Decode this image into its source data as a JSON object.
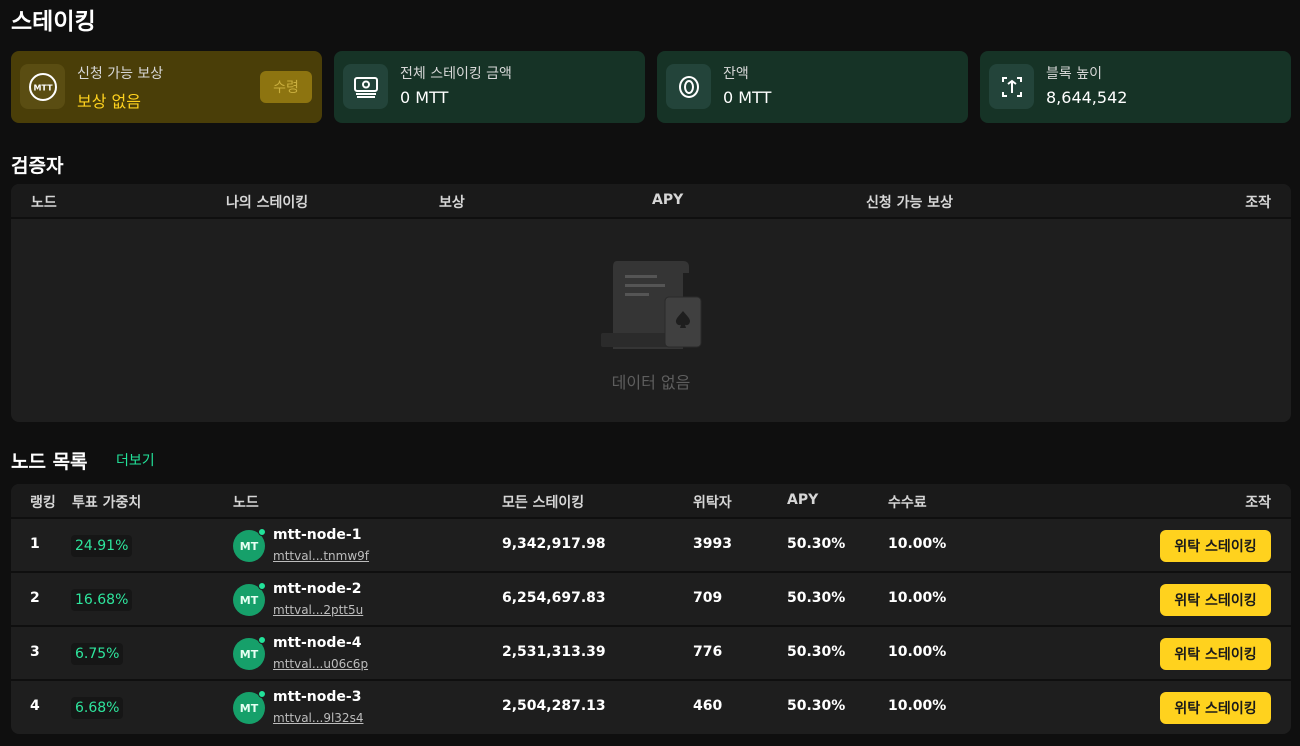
{
  "page": {
    "title": "스테이킹"
  },
  "cards": {
    "reward": {
      "label": "신청 가능 보상",
      "value": "보상 없음",
      "button": "수령",
      "icon": "mtt-coin-icon",
      "icon_text": "MTT"
    },
    "total": {
      "label": "전체 스테이킹 금액",
      "value": "0 MTT",
      "icon": "money-stack-icon"
    },
    "balance": {
      "label": "잔액",
      "value": "0 MTT",
      "icon": "coin-icon"
    },
    "block": {
      "label": "블록 높이",
      "value": "8,644,542",
      "icon": "block-icon"
    }
  },
  "validators": {
    "title": "검증자",
    "columns": [
      "노드",
      "나의 스테이킹",
      "보상",
      "APY",
      "신청 가능 보상",
      "조작"
    ],
    "empty_text": "데이터 없음"
  },
  "nodes": {
    "title": "노드 목록",
    "more": "더보기",
    "columns": [
      "랭킹",
      "투표 가중치",
      "노드",
      "모든 스테이킹",
      "위탁자",
      "APY",
      "수수료",
      "조작"
    ],
    "rows": [
      {
        "rank": "1",
        "weight": "24.91%",
        "avatar": "MT",
        "name": "mtt-node-1",
        "addr": "mttval...tnmw9f",
        "stake": "9,342,917.98",
        "delegators": "3993",
        "apy": "50.30%",
        "fee": "10.00%",
        "action": "위탁 스테이킹"
      },
      {
        "rank": "2",
        "weight": "16.68%",
        "avatar": "MT",
        "name": "mtt-node-2",
        "addr": "mttval...2ptt5u",
        "stake": "6,254,697.83",
        "delegators": "709",
        "apy": "50.30%",
        "fee": "10.00%",
        "action": "위탁 스테이킹"
      },
      {
        "rank": "3",
        "weight": "6.75%",
        "avatar": "MT",
        "name": "mtt-node-4",
        "addr": "mttval...u06c6p",
        "stake": "2,531,313.39",
        "delegators": "776",
        "apy": "50.30%",
        "fee": "10.00%",
        "action": "위탁 스테이킹"
      },
      {
        "rank": "4",
        "weight": "6.68%",
        "avatar": "MT",
        "name": "mtt-node-3",
        "addr": "mttval...9l32s4",
        "stake": "2,504,287.13",
        "delegators": "460",
        "apy": "50.30%",
        "fee": "10.00%",
        "action": "위탁 스테이킹"
      }
    ]
  }
}
